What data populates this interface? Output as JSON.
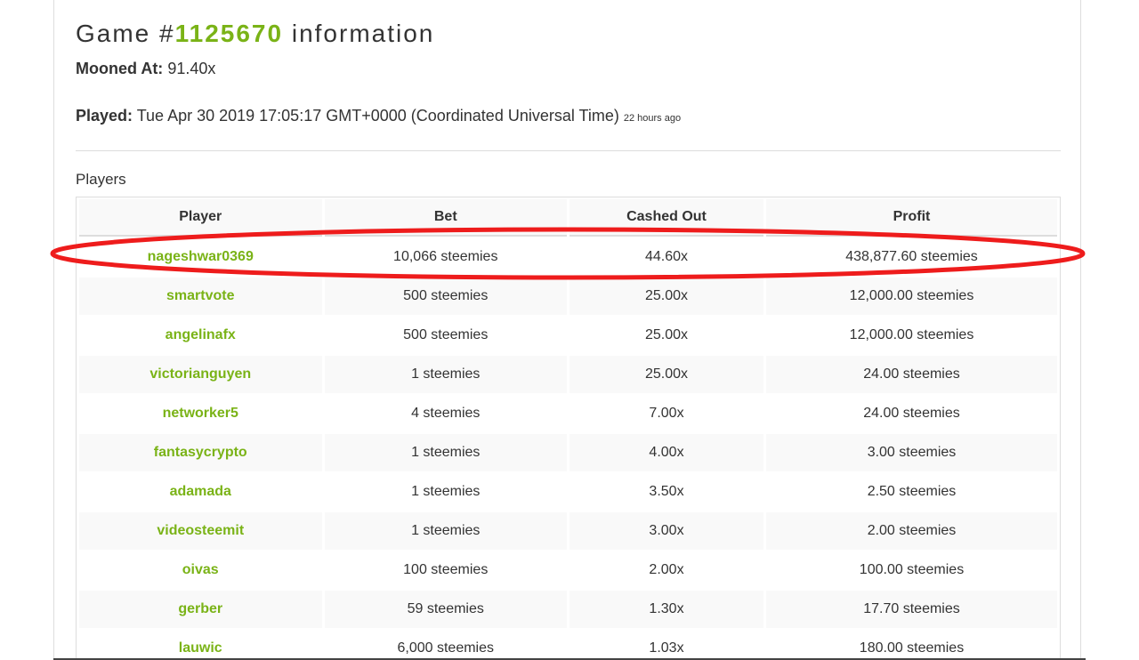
{
  "game": {
    "title_prefix": "Game #",
    "id": "1125670",
    "title_suffix": " information"
  },
  "mooned": {
    "label": "Mooned At:",
    "value": "91.40x"
  },
  "played": {
    "label": "Played:",
    "value": "Tue Apr 30 2019 17:05:17 GMT+0000 (Coordinated Universal Time)",
    "ago": "22 hours ago"
  },
  "players": {
    "heading": "Players",
    "columns": [
      "Player",
      "Bet",
      "Cashed Out",
      "Profit"
    ],
    "rows": [
      {
        "player": "nageshwar0369",
        "bet": "10,066 steemies",
        "cashed_out": "44.60x",
        "profit": "438,877.60 steemies"
      },
      {
        "player": "smartvote",
        "bet": "500 steemies",
        "cashed_out": "25.00x",
        "profit": "12,000.00 steemies"
      },
      {
        "player": "angelinafx",
        "bet": "500 steemies",
        "cashed_out": "25.00x",
        "profit": "12,000.00 steemies"
      },
      {
        "player": "victorianguyen",
        "bet": "1 steemies",
        "cashed_out": "25.00x",
        "profit": "24.00 steemies"
      },
      {
        "player": "networker5",
        "bet": "4 steemies",
        "cashed_out": "7.00x",
        "profit": "24.00 steemies"
      },
      {
        "player": "fantasycrypto",
        "bet": "1 steemies",
        "cashed_out": "4.00x",
        "profit": "3.00 steemies"
      },
      {
        "player": "adamada",
        "bet": "1 steemies",
        "cashed_out": "3.50x",
        "profit": "2.50 steemies"
      },
      {
        "player": "videosteemit",
        "bet": "1 steemies",
        "cashed_out": "3.00x",
        "profit": "2.00 steemies"
      },
      {
        "player": "oivas",
        "bet": "100 steemies",
        "cashed_out": "2.00x",
        "profit": "100.00 steemies"
      },
      {
        "player": "gerber",
        "bet": "59 steemies",
        "cashed_out": "1.30x",
        "profit": "17.70 steemies"
      },
      {
        "player": "lauwic",
        "bet": "6,000 steemies",
        "cashed_out": "1.03x",
        "profit": "180.00 steemies"
      }
    ]
  },
  "colors": {
    "accent_green": "#7ab317",
    "highlight_red": "#ee1c1c"
  }
}
